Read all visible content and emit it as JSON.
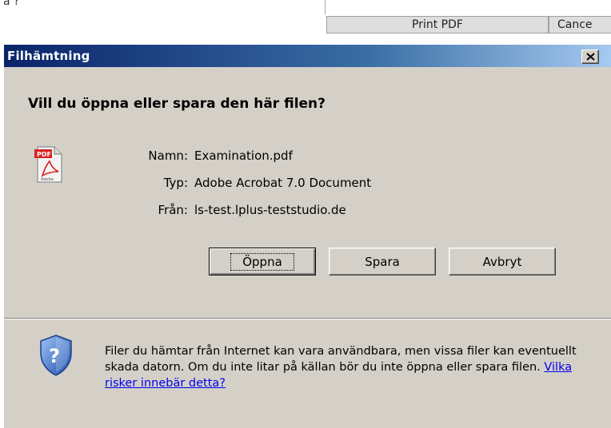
{
  "background": {
    "corner_text": "a ?",
    "print_pdf_label": "Print PDF",
    "cancel_label": "Cance"
  },
  "dialog": {
    "title": "Filhämtning",
    "question": "Vill du öppna eller spara den här filen?",
    "file": {
      "name_label": "Namn:",
      "name_value": "Examination.pdf",
      "type_label": "Typ:",
      "type_value": "Adobe Acrobat 7.0 Document",
      "from_label": "Från:",
      "from_value": "ls-test.lplus-teststudio.de"
    },
    "buttons": {
      "open": "Öppna",
      "save": "Spara",
      "cancel": "Avbryt"
    },
    "warning": {
      "text": "Filer du hämtar från Internet kan vara användbara, men vissa filer kan eventuellt skada datorn. Om du inte litar på källan bör du inte öppna eller spara filen. ",
      "link": "Vilka risker innebär detta?"
    },
    "icons": {
      "file": "pdf-file-icon",
      "warning": "shield-question-icon",
      "close": "close-icon"
    },
    "colors": {
      "title_start": "#0a246a",
      "title_end": "#a6caf0",
      "face": "#d4d0c8"
    }
  }
}
